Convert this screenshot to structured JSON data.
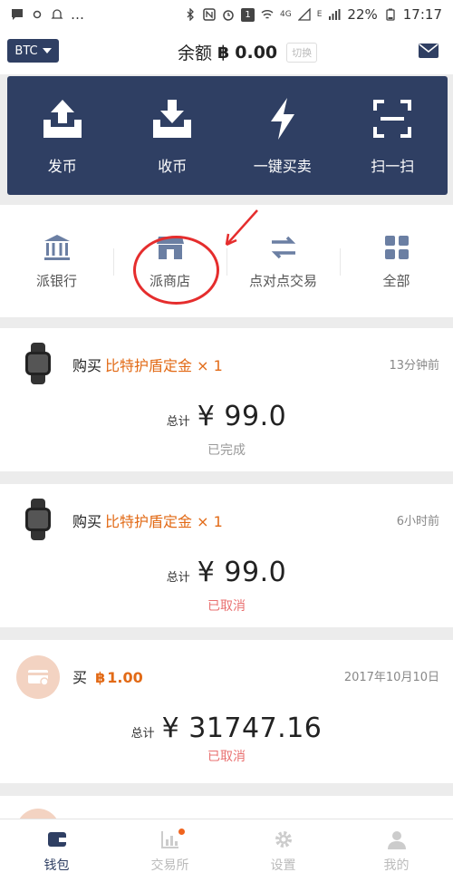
{
  "status_bar": {
    "battery": "22%",
    "time": "17:17",
    "network": "4G",
    "network2": "E",
    "sim_badge": "1"
  },
  "header": {
    "coin": "BTC",
    "balance_label": "余额",
    "balance_symbol": "฿",
    "balance_value": "0.00",
    "switch_label": "切换"
  },
  "actions": [
    {
      "label": "发币",
      "icon": "upload-tray-icon"
    },
    {
      "label": "收币",
      "icon": "download-tray-icon"
    },
    {
      "label": "一键买卖",
      "icon": "lightning-icon"
    },
    {
      "label": "扫一扫",
      "icon": "scan-icon"
    }
  ],
  "quick_nav": [
    {
      "label": "派银行",
      "icon": "bank-icon"
    },
    {
      "label": "派商店",
      "icon": "store-icon"
    },
    {
      "label": "点对点交易",
      "icon": "exchange-arrows-icon"
    },
    {
      "label": "全部",
      "icon": "grid-icon"
    }
  ],
  "orders": [
    {
      "action": "购买",
      "item": "比特护盾定金 × 1",
      "time": "13分钟前",
      "total_label": "总计",
      "total": "¥ 99.0",
      "status": "已完成"
    },
    {
      "action": "购买",
      "item": "比特护盾定金 × 1",
      "time": "6小时前",
      "total_label": "总计",
      "total": "¥ 99.0",
      "status": "已取消"
    },
    {
      "action": "买",
      "btc_symbol": "฿",
      "btc_value": "1.00",
      "time": "2017年10月10日",
      "total_label": "总计",
      "total": "¥ 31747.16",
      "status": "已取消"
    }
  ],
  "bottom_nav": [
    {
      "label": "钱包",
      "icon": "wallet-icon"
    },
    {
      "label": "交易所",
      "icon": "chart-icon"
    },
    {
      "label": "设置",
      "icon": "gear-icon"
    },
    {
      "label": "我的",
      "icon": "person-icon"
    }
  ],
  "colors": {
    "primary": "#2f3f63",
    "accent_orange": "#e26a16",
    "cancel_red": "#e97070",
    "annotation_red": "#e52d2d"
  }
}
